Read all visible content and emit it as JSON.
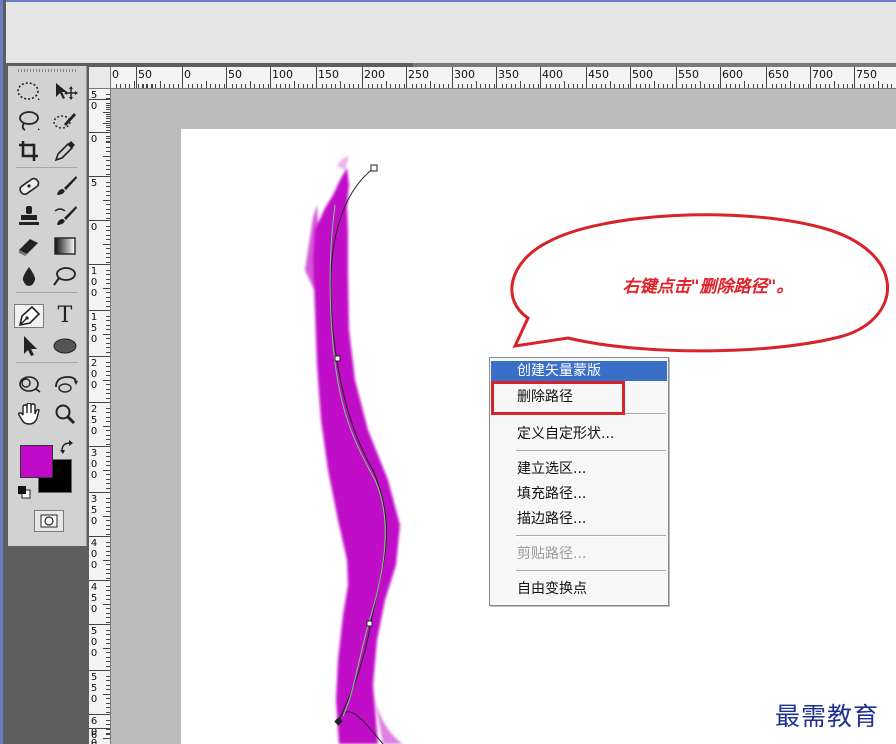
{
  "colors": {
    "foreground": "#c00ac8",
    "background": "#000000",
    "brush": "#c00ac8",
    "menu_highlight": "#3a6fc8",
    "annotation_red": "#d8232a",
    "path_line": "#7ad07a"
  },
  "tools": [
    {
      "name": "marquee-tool",
      "icon": "dotted-ellipse-icon"
    },
    {
      "name": "move-tool",
      "icon": "move-arrow-icon"
    },
    {
      "name": "lasso-tool",
      "icon": "lasso-icon"
    },
    {
      "name": "quick-selection-tool",
      "icon": "quick-selection-brush-icon"
    },
    {
      "name": "crop-tool",
      "icon": "crop-icon"
    },
    {
      "name": "eyedropper-tool",
      "icon": "eyedropper-icon"
    },
    {
      "name": "healing-brush-tool",
      "icon": "bandage-icon"
    },
    {
      "name": "brush-tool",
      "icon": "paintbrush-icon"
    },
    {
      "name": "clone-stamp-tool",
      "icon": "stamp-icon"
    },
    {
      "name": "history-brush-tool",
      "icon": "history-brush-icon"
    },
    {
      "name": "eraser-tool",
      "icon": "eraser-icon"
    },
    {
      "name": "gradient-tool",
      "icon": "gradient-icon"
    },
    {
      "name": "blur-tool",
      "icon": "water-drop-icon"
    },
    {
      "name": "dodge-tool",
      "icon": "dodge-icon"
    },
    {
      "name": "pen-tool",
      "icon": "pen-nib-icon"
    },
    {
      "name": "type-tool",
      "icon": "type-t-icon",
      "glyph": "T"
    },
    {
      "name": "path-selection-tool",
      "icon": "arrow-cursor-icon"
    },
    {
      "name": "ellipse-tool",
      "icon": "ellipse-shape-icon"
    },
    {
      "name": "3d-rotate-tool",
      "icon": "3d-rotate-icon"
    },
    {
      "name": "3d-orbit-tool",
      "icon": "3d-orbit-icon"
    },
    {
      "name": "hand-tool",
      "icon": "hand-icon"
    },
    {
      "name": "zoom-tool",
      "icon": "magnifier-icon"
    }
  ],
  "ruler": {
    "horizontal": [
      "0",
      "50",
      "0",
      "50",
      "100",
      "150",
      "200",
      "250",
      "300",
      "350",
      "400",
      "450",
      "500",
      "550",
      "600",
      "650",
      "700",
      "750"
    ],
    "vertical": [
      "5",
      "0",
      "0",
      "5",
      "0",
      "1 0 0",
      "1 5 0",
      "2 0 0",
      "2 5 0",
      "3 0 0",
      "3 5 0",
      "4 0 0",
      "4 5 0",
      "5 0 0",
      "5 5 0",
      "6 0 0",
      "6 5"
    ]
  },
  "callout": {
    "text": "右键点击\"删除路径\"。"
  },
  "context_menu": {
    "items": [
      {
        "label": "创建矢量蒙版",
        "state": "highlight"
      },
      {
        "label": "删除路径",
        "state": "normal"
      },
      {
        "label": "定义自定形状...",
        "state": "normal"
      },
      {
        "label": "建立选区...",
        "state": "normal"
      },
      {
        "label": "填充路径...",
        "state": "normal"
      },
      {
        "label": "描边路径...",
        "state": "normal"
      },
      {
        "label": "剪贴路径...",
        "state": "disabled"
      },
      {
        "label": "自由变换点",
        "state": "normal"
      }
    ]
  },
  "watermark": "最需教育"
}
